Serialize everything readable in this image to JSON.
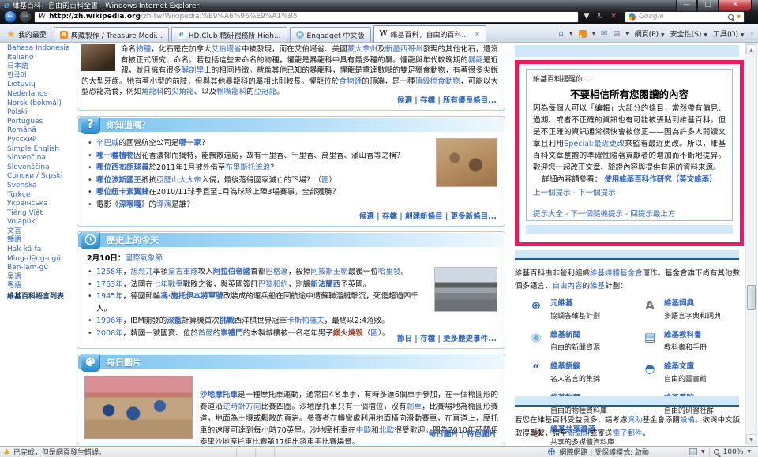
{
  "colors": {
    "highlight": "#ea1a5c",
    "link": "#3366bb",
    "strip": "#cfe9fb",
    "strip_border": "#1f5c8b"
  },
  "window": {
    "title": "維基百科，自由的百科全書 - Windows Internet Explorer",
    "url_host": "http://zh.wikipedia.org",
    "url_path": "/zh-tw/Wikipedia:%E9%A6%96%E9%A1%B5",
    "search_placeholder": "Google",
    "favorites_label": "我的最愛",
    "tabs": [
      {
        "label": "典藏製作 / Treasure Medi..."
      },
      {
        "label": "HD.Club 精研視務所 High..."
      },
      {
        "label": "Engadget 中文版"
      },
      {
        "label": "維基百科，自由的百科...",
        "close": "x"
      }
    ],
    "command_buttons": {
      "page": "網頁(P)",
      "security": "安全性(S)",
      "tools": "工具(O)"
    }
  },
  "sidebar": {
    "languages": [
      "Bahasa Indonesia",
      "Italiano",
      "日本語",
      "한국어",
      "Lietuvių",
      "Nederlands",
      "Norsk (bokmål)",
      "Polski",
      "Português",
      "Română",
      "Русский",
      "Simple English",
      "Slovenčina",
      "Slovenščina",
      "Српски / Srpski",
      "Svenska",
      "Türkçe",
      "Українська",
      "Tiếng Việt",
      "Volapük",
      "文言",
      "贛語",
      "Hak-kâ-fa",
      "Mìng-dĕ̤ng-ngṳ̄",
      "Bân-lâm-gú",
      "吴语",
      "粵語"
    ],
    "footer": "維基百科語言列表"
  },
  "featured": {
    "paragraph": [
      {
        "t": "命名"
      },
      {
        "t": "物種",
        "s": "l"
      },
      {
        "t": "，化石是在加拿大"
      },
      {
        "t": "艾伯塔省",
        "s": "l"
      },
      {
        "t": "中被發現，而在艾伯塔省、美國"
      },
      {
        "t": "蒙大拿州",
        "s": "l"
      },
      {
        "t": "及"
      },
      {
        "t": "新墨西哥州",
        "s": "l"
      },
      {
        "t": "發現的其他化石，還沒有被正式研究、命名。若包括這些未命名的物種，懼龍是暴龍科中具有最多種的屬。懼龍與年代較晚期的"
      },
      {
        "t": "暴龍",
        "s": "l"
      },
      {
        "t": "是近親，並且擁有很多"
      },
      {
        "t": "解剖學",
        "s": "l"
      },
      {
        "t": "上的相同特徵。就像其他已知的暴龍科，懼龍是重達數噸的雙足獵食動物，有著很多尖銳的大型牙齒。牠有著小型的前肢，但與其他暴龍科的屬相比則較長。懼龍位於"
      },
      {
        "t": "食物鏈",
        "s": "l"
      },
      {
        "t": "的頂端，是一種"
      },
      {
        "t": "頂級掠食動物",
        "s": "l"
      },
      {
        "t": "，可能以大型恐龍為食，例如"
      },
      {
        "t": "角龍科",
        "s": "l"
      },
      {
        "t": "的"
      },
      {
        "t": "尖角龍",
        "s": "l"
      },
      {
        "t": "、以及"
      },
      {
        "t": "鴨嘴龍科",
        "s": "l"
      },
      {
        "t": "的"
      },
      {
        "t": "亞冠龍",
        "s": "l"
      },
      {
        "t": "。"
      }
    ],
    "footer_links": [
      "候選",
      "存檔",
      "所有優良條目..."
    ]
  },
  "dyk": {
    "title": "你知道嗎？",
    "items": [
      {
        "runs": [
          {
            "t": "辛巴威",
            "s": "l"
          },
          {
            "t": "的國營航空公司是"
          },
          {
            "t": "哪一家",
            "s": "b"
          },
          {
            "t": "？"
          }
        ]
      },
      {
        "runs": [
          {
            "t": "哪一種植物",
            "s": "b"
          },
          {
            "t": "因花香濃郁而獨特，能飄散遠處，故有十里香、千里香、萬里香、滿山香等之稱？"
          }
        ]
      },
      {
        "runs": [
          {
            "t": "哪位西布朗球員",
            "s": "b"
          },
          {
            "t": "於2011年1月被外借至"
          },
          {
            "t": "布里斯托流浪",
            "s": "l"
          },
          {
            "t": "？"
          }
        ]
      },
      {
        "runs": [
          {
            "t": "哪位波斯國王",
            "s": "b"
          },
          {
            "t": "抵抗"
          },
          {
            "t": "亞歷山大大帝",
            "s": "l"
          },
          {
            "t": "入侵，最後落得國家滅亡的下場？（"
          },
          {
            "t": "圖",
            "s": "l"
          },
          {
            "t": "）"
          }
        ]
      },
      {
        "runs": [
          {
            "t": "哪位紐卡素翼鋒",
            "s": "b"
          },
          {
            "t": "在2010/11球季直至1月為球隊上陣3場賽事，全部獲勝？"
          }
        ]
      },
      {
        "runs": [
          {
            "t": "電影《"
          },
          {
            "t": "深喉嚨",
            "s": "b"
          },
          {
            "t": "》的"
          },
          {
            "t": "導演",
            "s": "l"
          },
          {
            "t": "是誰？"
          }
        ]
      }
    ],
    "footer_links": [
      "候選",
      "存檔",
      "創建新條目",
      "更多新條目..."
    ]
  },
  "history": {
    "title": "歷史上的今天",
    "date_line": [
      {
        "t": "2月10日：",
        "s": "B"
      },
      {
        "t": "國際氣象節",
        "s": "l"
      }
    ],
    "items": [
      {
        "runs": [
          {
            "t": "1258年",
            "s": "l"
          },
          {
            "t": "，"
          },
          {
            "t": "旭烈兀",
            "s": "l"
          },
          {
            "t": "率領"
          },
          {
            "t": "蒙古軍隊",
            "s": "l"
          },
          {
            "t": "攻入"
          },
          {
            "t": "阿拉伯帝國",
            "s": "b"
          },
          {
            "t": "首都"
          },
          {
            "t": "巴格達",
            "s": "l"
          },
          {
            "t": "，殺掉"
          },
          {
            "t": "阿拔斯王朝",
            "s": "l"
          },
          {
            "t": "最後一位"
          },
          {
            "t": "哈里發",
            "s": "l"
          },
          {
            "t": "。"
          }
        ]
      },
      {
        "runs": [
          {
            "t": "1763年",
            "s": "l"
          },
          {
            "t": "，法國在"
          },
          {
            "t": "七年戰爭",
            "s": "l"
          },
          {
            "t": "戰敗之後，與英國簽訂"
          },
          {
            "t": "巴黎和約",
            "s": "l"
          },
          {
            "t": "，割讓"
          },
          {
            "t": "新法蘭西",
            "s": "b"
          },
          {
            "t": "予英國。"
          }
        ]
      },
      {
        "runs": [
          {
            "t": "1945年",
            "s": "l"
          },
          {
            "t": "，德國郵輪"
          },
          {
            "t": "馮·施托伊本將軍號",
            "s": "b"
          },
          {
            "t": "改裝成的運兵船在回航途中遭蘇聯潛艇擊沉，死傷超過四千人。"
          }
        ]
      },
      {
        "runs": [
          {
            "t": "1996年",
            "s": "l"
          },
          {
            "t": "，IBM開發的"
          },
          {
            "t": "深藍",
            "s": "b"
          },
          {
            "t": "計算機首次"
          },
          {
            "t": "挑戰",
            "s": "b"
          },
          {
            "t": "西洋棋世界冠軍"
          },
          {
            "t": "卡斯帕羅夫",
            "s": "l"
          },
          {
            "t": "，最終以2:4落敗。"
          }
        ]
      },
      {
        "runs": [
          {
            "t": "2008年",
            "s": "l"
          },
          {
            "t": "，韓國一號國寶、位於"
          },
          {
            "t": "首爾",
            "s": "l"
          },
          {
            "t": "的"
          },
          {
            "t": "崇禮門",
            "s": "b"
          },
          {
            "t": "的木製城樓被一名老年男子"
          },
          {
            "t": "縱火燒毀",
            "s": "r"
          },
          {
            "t": "（"
          },
          {
            "t": "圖",
            "s": "l"
          },
          {
            "t": "）。"
          }
        ]
      }
    ],
    "footer_links": [
      "節日",
      "存檔",
      "更多歷史事件..."
    ]
  },
  "potd": {
    "title": "每日圖片",
    "paragraph": [
      {
        "t": "沙地摩托車",
        "s": "b"
      },
      {
        "t": "是一種摩托車運動，通常由4名車手，有時多達6個車手參加，在一個橢圓形的賽道沿"
      },
      {
        "t": "逆時針方向",
        "s": "l"
      },
      {
        "t": "比賽四圈。沙地摩托車只有一個檔位，沒有"
      },
      {
        "t": "剎車",
        "s": "l"
      },
      {
        "t": "，比賽場地為橢圓形賽道，地面為土壤或鬆散的頁岩。參賽者在轉彎處利用地面橫向滑動賽車，在直道上，摩托車的速度可達到每小時70英里。沙地摩托車在"
      },
      {
        "t": "中歐",
        "s": "l"
      },
      {
        "t": "和"
      },
      {
        "t": "北歐",
        "s": "l"
      },
      {
        "t": "很受歡迎。圖為2010年芬蘭伊泰里沙地摩托車比賽第17組出發車手比賽場景。"
      }
    ],
    "footer_links": [
      "每日圖片",
      "特色圖片"
    ]
  },
  "tip_box": {
    "header": "維基百科提醒你…",
    "title": "不要相信所有您閱讀的內容",
    "body": [
      {
        "t": "因為每個人可以「編輯」大部分的條目，當然帶有偏見、過期、或者不正確的資訊也有可能被張貼到維基百科。但是不正確的資訊通常很快會被修正——因為許多人閱讀文章且利用"
      },
      {
        "t": "Special:最近更改",
        "s": "l"
      },
      {
        "t": "來監看最近更改。所以，維基百科文章整體的準確性隨著貢獻者的增加而不斷地提昇。歡迎您一起改正文章、驗證內容與提供有用的資料來源。"
      }
    ],
    "detail_prefix": "詳細內容請參看：",
    "detail_link": "使用維基百科作研究（英文維基）",
    "nav1": [
      "上一個提示",
      "下一個提示"
    ],
    "nav2": [
      "提示大全",
      "下一個隨機提示",
      "回提示最上方"
    ]
  },
  "sister": {
    "intro": [
      {
        "t": "維基百科由非營利組織"
      },
      {
        "t": "維基媒體基金會",
        "s": "l"
      },
      {
        "t": "運作。基金會旗下尚有其他數個多語言、"
      },
      {
        "t": "自由內容",
        "s": "l"
      },
      {
        "t": "的"
      },
      {
        "t": "維基",
        "s": "l"
      },
      {
        "t": "計劃："
      }
    ],
    "col1": [
      {
        "icon": "meta-wiki-icon",
        "glyph": "⊕",
        "color": "#2a6fb8",
        "name": "元維基",
        "desc": "協調各維基計劃"
      },
      {
        "icon": "wikinews-icon",
        "glyph": "◉",
        "color": "#7fb2dd",
        "name": "維基新聞",
        "desc": "自由的新聞資源"
      },
      {
        "icon": "wikiquote-icon",
        "glyph": "“",
        "color": "#1f4e79",
        "name": "維基語錄",
        "desc": "名人名言的集錦"
      },
      {
        "icon": "wikispecies-icon",
        "glyph": "≡",
        "color": "#3f8f3f",
        "name": "維基物種",
        "desc": "自由的物種資料庫"
      },
      {
        "icon": "commons-icon",
        "glyph": "◎",
        "color": "#b01717",
        "name": "維基共享資源",
        "desc": "共享的多媒體資料庫"
      }
    ],
    "col2": [
      {
        "icon": "wiktionary-icon",
        "glyph": "A",
        "color": "#777777",
        "name": "維基詞典",
        "desc": "多語言字典和詞典"
      },
      {
        "icon": "wikibooks-icon",
        "glyph": "▤",
        "color": "#2e75b6",
        "name": "維基教科書",
        "desc": "教科書和手冊"
      },
      {
        "icon": "wikisource-icon",
        "glyph": "◓",
        "color": "#2e75b6",
        "name": "維基文庫",
        "desc": "自由的圖書館"
      },
      {
        "icon": "wikiversity-icon",
        "glyph": "⌂",
        "color": "#2e75b6",
        "name": "維基學院",
        "desc": "自由的研習社群"
      }
    ]
  },
  "donation": [
    {
      "t": "若您在維基百科受益良多，請考慮"
    },
    {
      "t": "資助",
      "s": "l"
    },
    {
      "t": "基金會添購"
    },
    {
      "t": "設備",
      "s": "l"
    },
    {
      "t": "。欲與中文版取得聯繫，請至"
    },
    {
      "t": "新聞組",
      "s": "l"
    },
    {
      "t": "或寄送"
    },
    {
      "t": "電子郵件",
      "s": "l"
    },
    {
      "t": "。"
    }
  ],
  "statusbar": {
    "left": "已完成，但是網頁發生錯誤。",
    "zone": "網際網路 | 受保護模式: 啟動",
    "zoom": "100%"
  }
}
